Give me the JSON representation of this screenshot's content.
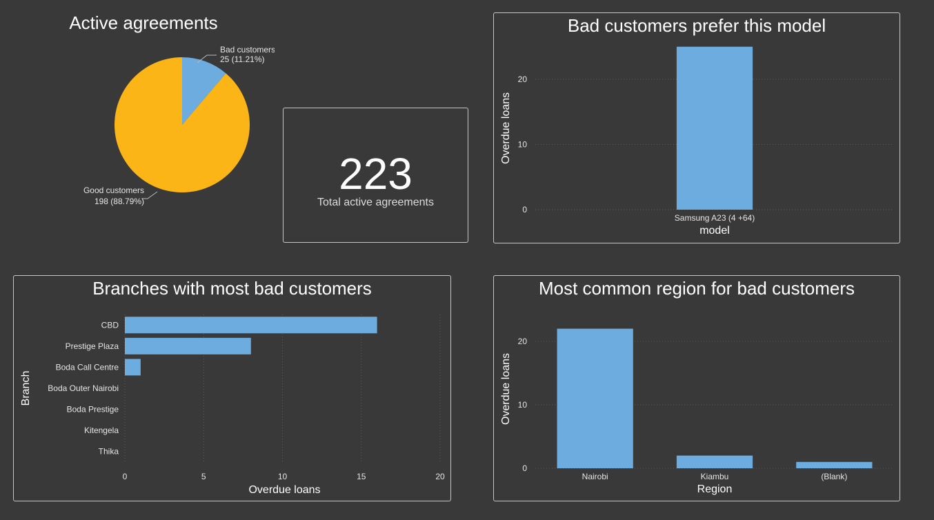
{
  "colors": {
    "background": "#393939",
    "bar": "#6cacdf",
    "pie_good": "#fbb516",
    "pie_bad": "#6cacdf",
    "gridline": "#5e5e5e",
    "panel_border": "#c8c8c8"
  },
  "kpi": {
    "value": "223",
    "label": "Total active agreements"
  },
  "chart_data": [
    {
      "id": "active",
      "type": "pie",
      "title": "Active agreements",
      "slices": [
        {
          "label": "Bad customers",
          "value": 25,
          "percent": "11.21%",
          "display": "25 (11.21%)"
        },
        {
          "label": "Good customers",
          "value": 198,
          "percent": "88.79%",
          "display": "198 (88.79%)"
        }
      ]
    },
    {
      "id": "model",
      "type": "bar",
      "title": "Bad customers prefer this model",
      "categories": [
        "Samsung A23 (4 +64)"
      ],
      "values": [
        25
      ],
      "xlabel": "model",
      "ylabel": "Overdue loans",
      "ylim": [
        0,
        25
      ],
      "yticks": [
        0,
        10,
        20
      ],
      "grid": true
    },
    {
      "id": "branches",
      "type": "bar",
      "orientation": "horizontal",
      "title": "Branches with most bad customers",
      "categories": [
        "CBD",
        "Prestige Plaza",
        "Boda Call Centre",
        "Boda Outer Nairobi",
        "Boda Prestige",
        "Kitengela",
        "Thika"
      ],
      "values": [
        16,
        8,
        1,
        0,
        0,
        0,
        0
      ],
      "xlabel": "Overdue loans",
      "ylabel": "Branch",
      "xlim": [
        0,
        20
      ],
      "xticks": [
        0,
        5,
        10,
        15,
        20
      ],
      "grid": true
    },
    {
      "id": "region",
      "type": "bar",
      "title": "Most common region for bad customers",
      "categories": [
        "Nairobi",
        "Kiambu",
        "(Blank)"
      ],
      "values": [
        22,
        2,
        1
      ],
      "xlabel": "Region",
      "ylabel": "Overdue loans",
      "ylim": [
        0,
        25
      ],
      "yticks": [
        0,
        10,
        20
      ],
      "grid": true
    }
  ]
}
